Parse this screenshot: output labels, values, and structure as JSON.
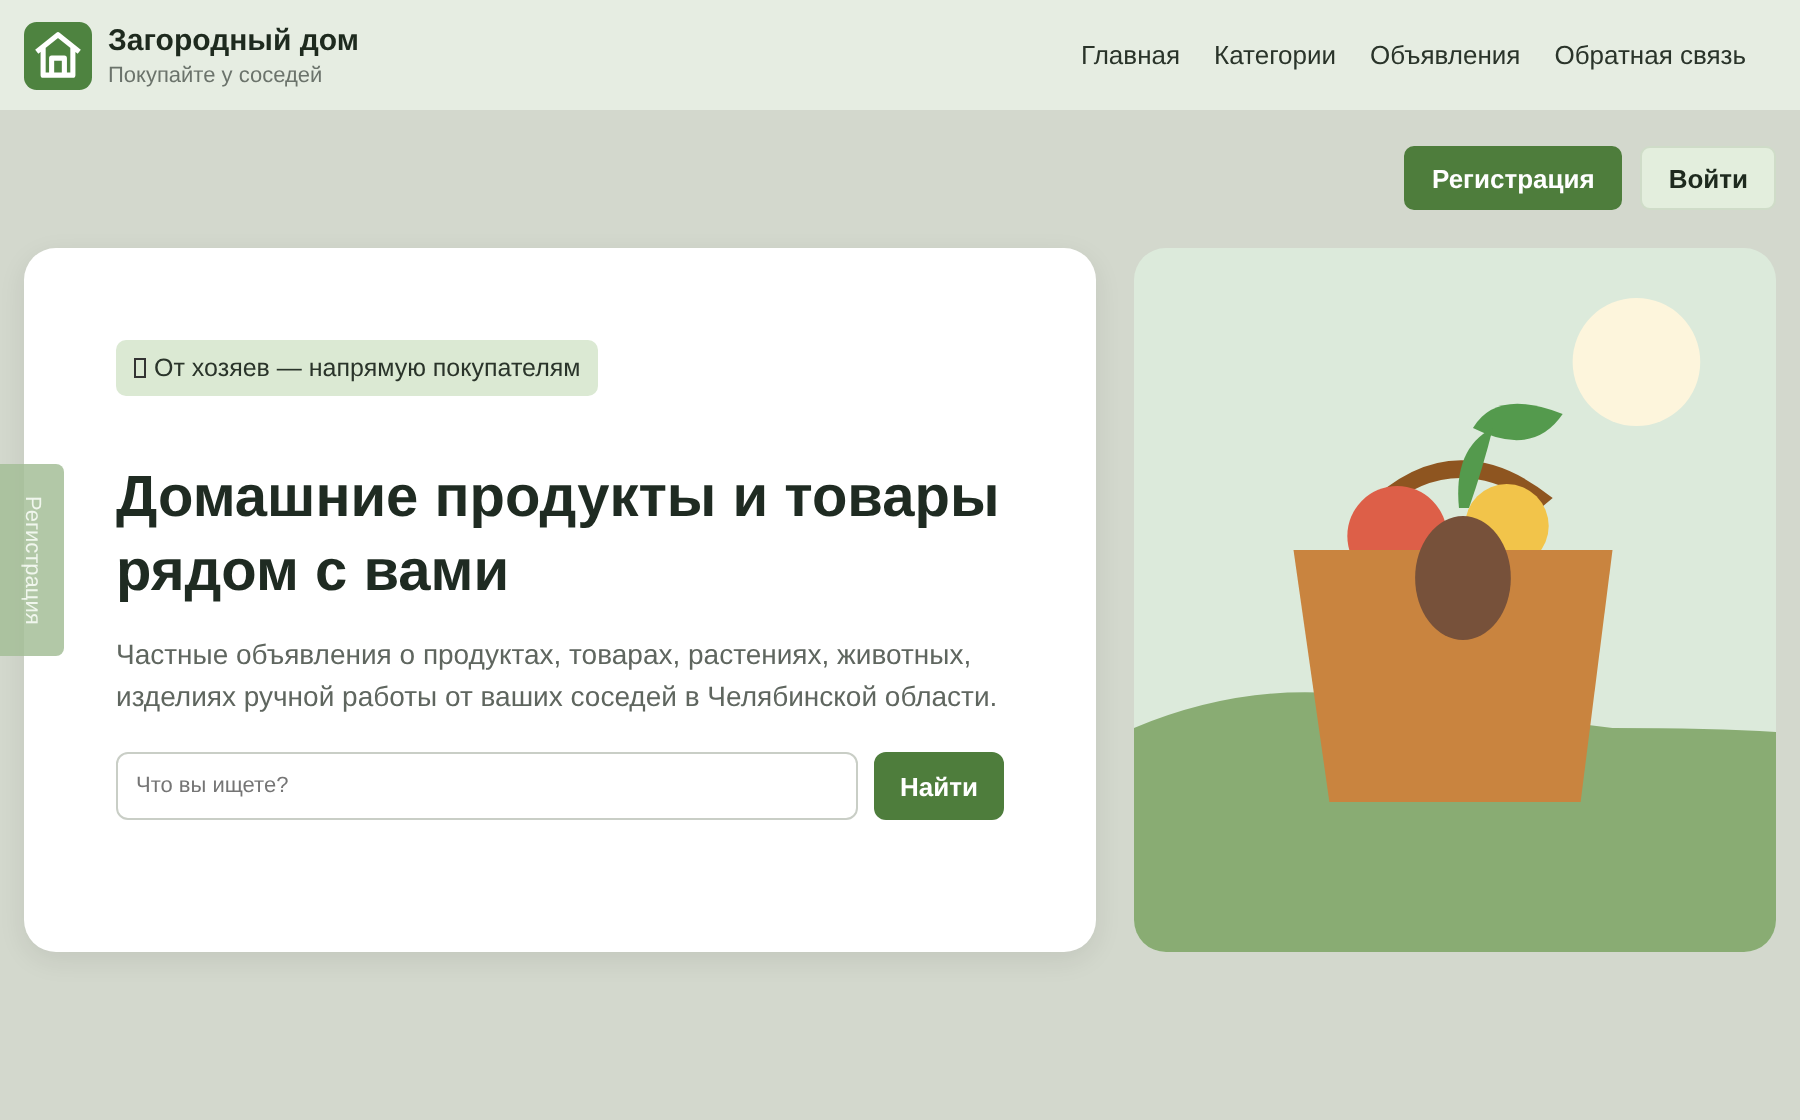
{
  "header": {
    "brand": {
      "title": "Загородный дом",
      "subtitle": "Покупайте у соседей"
    },
    "nav": [
      {
        "label": "Главная"
      },
      {
        "label": "Категории"
      },
      {
        "label": "Объявления"
      },
      {
        "label": "Обратная связь"
      }
    ]
  },
  "auth_buttons": [
    {
      "label": "Регистрация",
      "kind": "primary"
    },
    {
      "label": "Войти",
      "kind": "secondary"
    }
  ],
  "side_tab": {
    "label": "Регистрация"
  },
  "hero": {
    "badge": "От хозяев — напрямую покупателям",
    "title": "Домашние продукты и товары рядом с вами",
    "description": "Частные объявления о продуктах, товарах, растениях, животных, изделиях ручной работы от ваших соседей в Челябинской области.",
    "search": {
      "placeholder": "Что вы ищете?",
      "button": "Найти"
    }
  }
}
